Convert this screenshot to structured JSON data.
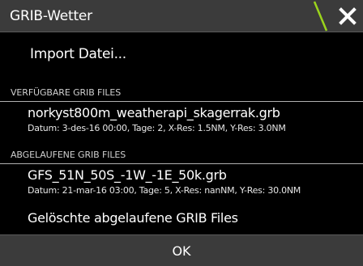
{
  "dialog": {
    "title": "GRIB-Wetter",
    "accent_color": "#9bd41c",
    "close_icon": "close-icon"
  },
  "actions": {
    "import_label": "Import Datei...",
    "delete_expired_label": "Gelöschte abgelaufene GRIB Files",
    "ok_label": "OK"
  },
  "sections": {
    "available": {
      "header": "VERFÜGBARE GRIB FILES",
      "files": [
        {
          "name": "norkyst800m_weatherapi_skagerrak.grb",
          "details": "Datum: 3-des-16 00:00, Tage: 2, X-Res: 1.5NM, Y-Res: 3.0NM"
        }
      ]
    },
    "expired": {
      "header": "ABGELAUFENE GRIB FILES",
      "files": [
        {
          "name": "GFS_51N_50S_-1W_-1E_50k.grb",
          "details": "Datum: 21-mar-16 03:00, Tage: 5, X-Res: nanNM, Y-Res: 30.0NM"
        }
      ]
    }
  }
}
